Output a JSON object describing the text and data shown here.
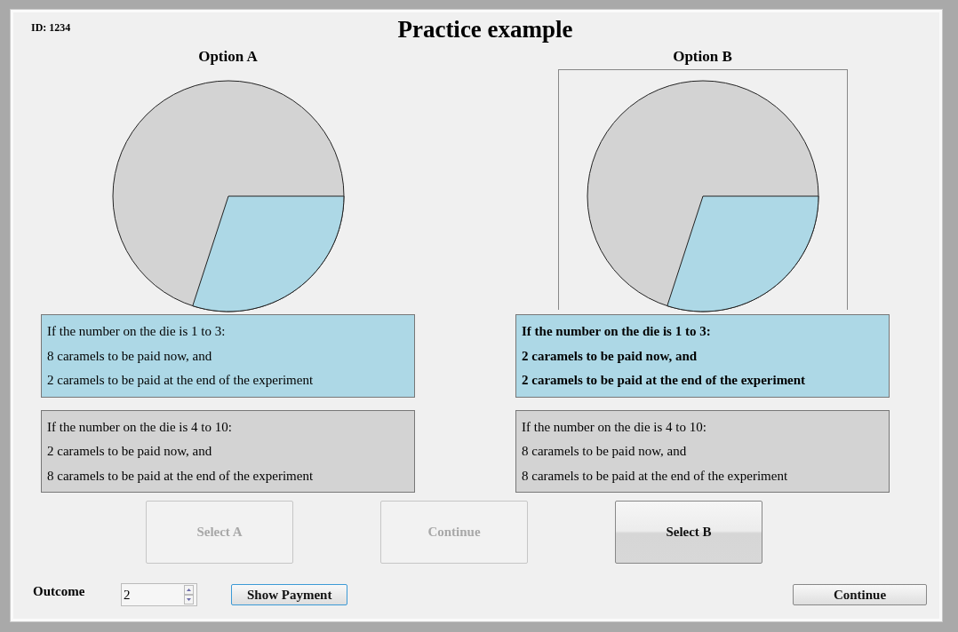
{
  "id_label": "ID: 1234",
  "title": "Practice example",
  "options": [
    {
      "heading": "Option A",
      "selected": false,
      "outcomes": [
        {
          "color": "#add8e6",
          "highlighted": false,
          "lines": [
            "If the number on the die is 1 to 3:",
            "8 caramels to be paid now, and",
            "2 caramels to be paid at the end of the experiment"
          ]
        },
        {
          "color": "#d3d3d3",
          "highlighted": false,
          "lines": [
            "If the number on the die is 4 to 10:",
            "2 caramels to be paid now, and",
            "8 caramels to be paid at the end of the experiment"
          ]
        }
      ]
    },
    {
      "heading": "Option B",
      "selected": true,
      "outcomes": [
        {
          "color": "#add8e6",
          "highlighted": true,
          "lines": [
            "If the number on the die is 1 to 3:",
            "2 caramels to be paid now, and",
            "2 caramels to be paid at the end of the experiment"
          ]
        },
        {
          "color": "#d3d3d3",
          "highlighted": false,
          "lines": [
            "If the number on the die is 4 to 10:",
            "8 caramels to be paid now, and",
            "8 caramels to be paid at the end of the experiment"
          ]
        }
      ]
    }
  ],
  "action_buttons": [
    {
      "label": "Select A",
      "disabled": true
    },
    {
      "label": "Continue",
      "disabled": true
    },
    {
      "label": "Select B",
      "disabled": false
    }
  ],
  "outcome": {
    "label": "Outcome",
    "value": "2"
  },
  "show_payment": {
    "label": "Show Payment",
    "focused": true
  },
  "continue_button": {
    "label": "Continue"
  }
}
